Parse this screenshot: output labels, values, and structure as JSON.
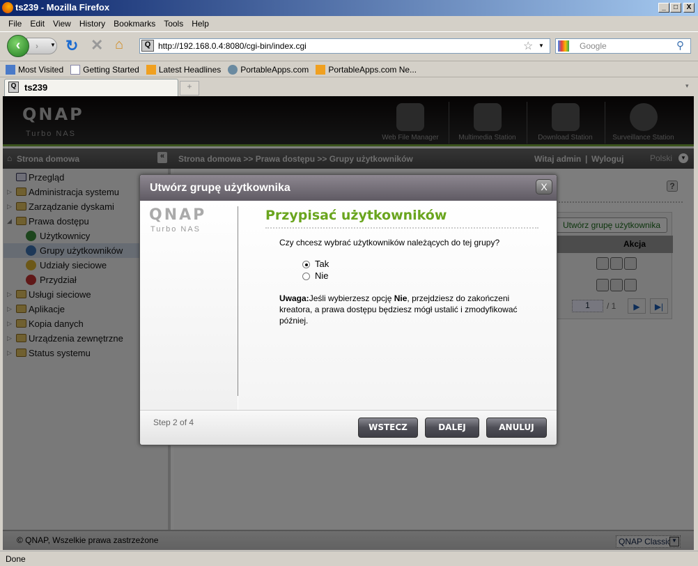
{
  "window": {
    "title": "ts239 - Mozilla Firefox",
    "min": "_",
    "max": "□",
    "close": "X"
  },
  "menu": [
    "File",
    "Edit",
    "View",
    "History",
    "Bookmarks",
    "Tools",
    "Help"
  ],
  "nav": {
    "url": "http://192.168.0.4:8080/cgi-bin/index.cgi",
    "search_placeholder": "Google"
  },
  "bookmarks": [
    "Most Visited",
    "Getting Started",
    "Latest Headlines",
    "PortableApps.com",
    "PortableApps.com Ne..."
  ],
  "tabs": [
    {
      "label": "ts239"
    }
  ],
  "qnap": {
    "logo": "QNAP",
    "sub": "Turbo NAS",
    "apps": [
      "Web File Manager",
      "Multimedia Station",
      "Download Station",
      "Surveillance Station"
    ],
    "home": "Strona domowa",
    "breadcrumb": "Strona domowa >> Prawa dostępu >> Grupy użytkowników",
    "welcome": "Witaj admin",
    "sep": "|",
    "logout": "Wyloguj",
    "language": "Polski"
  },
  "sidebar": [
    {
      "label": "Przegląd",
      "type": "leaf"
    },
    {
      "label": "Administracja systemu",
      "type": "folder"
    },
    {
      "label": "Zarządzanie dyskami",
      "type": "folder"
    },
    {
      "label": "Prawa dostępu",
      "type": "open"
    },
    {
      "label": "Użytkownicy",
      "type": "sub",
      "color": "#3a8a3a"
    },
    {
      "label": "Grupy użytkowników",
      "type": "sub",
      "color": "#3a70b0",
      "selected": true
    },
    {
      "label": "Udziały sieciowe",
      "type": "sub",
      "color": "#d8b030"
    },
    {
      "label": "Przydział",
      "type": "sub",
      "color": "#c03030"
    },
    {
      "label": "Usługi sieciowe",
      "type": "folder"
    },
    {
      "label": "Aplikacje",
      "type": "folder"
    },
    {
      "label": "Kopia danych",
      "type": "folder"
    },
    {
      "label": "Urządzenia zewnętrzne",
      "type": "folder"
    },
    {
      "label": "Status systemu",
      "type": "folder"
    }
  ],
  "main": {
    "help": "?",
    "create_button": "Utwórz grupę użytkownika",
    "col_action": "Akcja",
    "page": "1",
    "page_total": "/ 1"
  },
  "footer": {
    "copyright": "© QNAP, Wszelkie prawa zastrzeżone",
    "theme": "QNAP Classic"
  },
  "status": "Done",
  "modal": {
    "title": "Utwórz grupę użytkownika",
    "close": "X",
    "heading": "Przypisać użytkowników",
    "question": "Czy chcesz wybrać użytkowników należących do tej grupy?",
    "options": [
      {
        "label": "Tak",
        "checked": true
      },
      {
        "label": "Nie",
        "checked": false
      }
    ],
    "note_label": "Uwaga:",
    "note_pre": "Jeśli wybierzesz opcję ",
    "note_bold": "Nie",
    "note_post": ", przejdziesz do zakończeni kreatora, a prawa dostępu będziesz mógł ustalić i zmodyfikować później.",
    "step": "Step 2 of 4",
    "back": "WSTECZ",
    "next": "DALEJ",
    "cancel": "ANULUJ"
  },
  "colors": {
    "accent_green": "#6aa51e",
    "header_black": "#0b0707"
  }
}
